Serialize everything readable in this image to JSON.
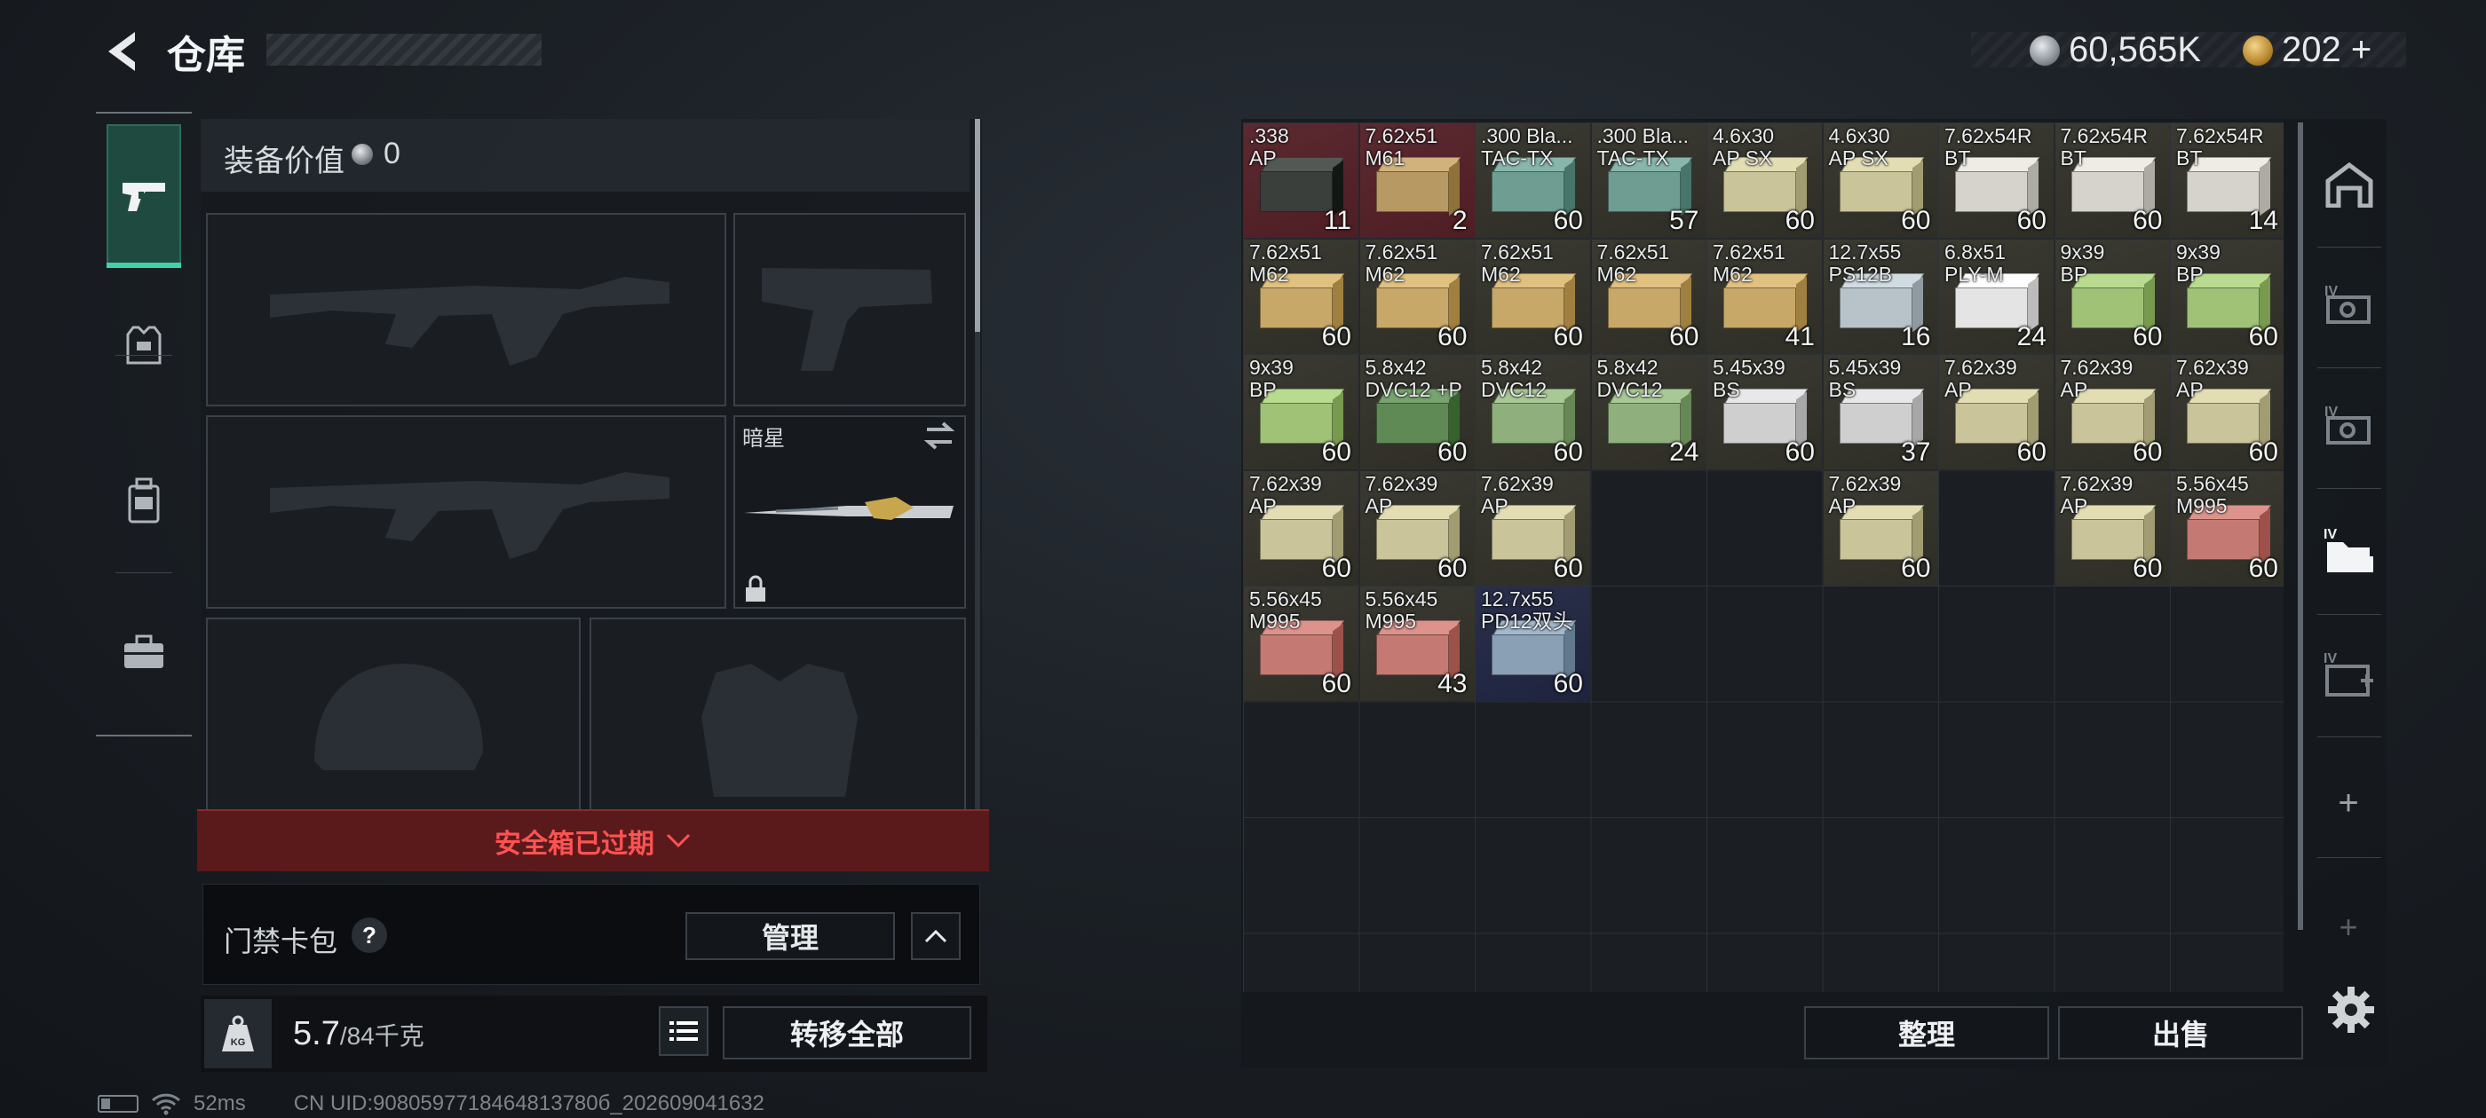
{
  "header": {
    "title": "仓库",
    "currency1": "60,565K",
    "currency2": "202",
    "currency2_add": "+"
  },
  "equipment": {
    "value_label": "装备价值",
    "value": "0",
    "melee_name": "暗星",
    "expired_text": "安全箱已过期",
    "card_pack_label": "门禁卡包",
    "help": "?",
    "manage_label": "管理",
    "weight_value": "5.7",
    "weight_max": "/84千克",
    "transfer_all_label": "转移全部",
    "kg_label": "KG"
  },
  "status": {
    "ping": "52ms",
    "uid": "CN UID:9080597718464813780б_202609041632"
  },
  "stash": {
    "sort_label": "整理",
    "sell_label": "出售",
    "items": [
      {
        "name": ".338\nAP",
        "count": "11",
        "color": "#3a3f3c",
        "bg": "#5a2a30"
      },
      {
        "name": "7.62x51\nM61",
        "count": "2",
        "color": "#b79a63",
        "bg": "#5a2a30"
      },
      {
        "name": ".300 Bla...\nTAC-TX",
        "count": "60",
        "color": "#6f9d92",
        "bg": "#3a3a32"
      },
      {
        "name": ".300 Bla...\nTAC-TX",
        "count": "57",
        "color": "#6f9d92",
        "bg": "#3a3a32"
      },
      {
        "name": "4.6x30\nAP SX",
        "count": "60",
        "color": "#c9c49a",
        "bg": "#3a3a32"
      },
      {
        "name": "4.6x30\nAP SX",
        "count": "60",
        "color": "#c9c49a",
        "bg": "#3a3a32"
      },
      {
        "name": "7.62x54R\nBT",
        "count": "60",
        "color": "#d6d3cc",
        "bg": "#3a3a32"
      },
      {
        "name": "7.62x54R\nBT",
        "count": "60",
        "color": "#d6d3cc",
        "bg": "#3a3a32"
      },
      {
        "name": "7.62x54R\nBT",
        "count": "14",
        "color": "#d6d3cc",
        "bg": "#3a3a32"
      },
      {
        "name": "7.62x51\nM62",
        "count": "60",
        "color": "#c8a868",
        "bg": "#3a3a32"
      },
      {
        "name": "7.62x51\nM62",
        "count": "60",
        "color": "#c8a868",
        "bg": "#3a3a32"
      },
      {
        "name": "7.62x51\nM62",
        "count": "60",
        "color": "#c8a868",
        "bg": "#3a3a32"
      },
      {
        "name": "7.62x51\nM62",
        "count": "60",
        "color": "#c8a868",
        "bg": "#3a3a32"
      },
      {
        "name": "7.62x51\nM62",
        "count": "41",
        "color": "#c8a868",
        "bg": "#3a3a32"
      },
      {
        "name": "12.7x55\nPS12B",
        "count": "16",
        "color": "#b7c3c8",
        "bg": "#3a3a32"
      },
      {
        "name": "6.8x51\nPLY-M",
        "count": "24",
        "color": "#e4e4e4",
        "bg": "#3a3a32"
      },
      {
        "name": "9x39\nBP",
        "count": "60",
        "color": "#9fc277",
        "bg": "#3a3a32"
      },
      {
        "name": "9x39\nBP",
        "count": "60",
        "color": "#9fc277",
        "bg": "#3a3a32"
      },
      {
        "name": "9x39\nBP",
        "count": "60",
        "color": "#9fc277",
        "bg": "#3a3a32"
      },
      {
        "name": "5.8x42\nDVC12 +P",
        "count": "60",
        "color": "#5f8a55",
        "bg": "#3a3a32"
      },
      {
        "name": "5.8x42\nDVC12",
        "count": "60",
        "color": "#8fb07c",
        "bg": "#3a3a32"
      },
      {
        "name": "5.8x42\nDVC12",
        "count": "24",
        "color": "#8fb07c",
        "bg": "#3a3a32"
      },
      {
        "name": "5.45x39\nBS",
        "count": "60",
        "color": "#cfcfcf",
        "bg": "#3a3a32"
      },
      {
        "name": "5.45x39\nBS",
        "count": "37",
        "color": "#cfcfcf",
        "bg": "#3a3a32"
      },
      {
        "name": "7.62x39\nAP",
        "count": "60",
        "color": "#c9c49a",
        "bg": "#3a3a32"
      },
      {
        "name": "7.62x39\nAP",
        "count": "60",
        "color": "#c9c49a",
        "bg": "#3a3a32"
      },
      {
        "name": "7.62x39\nAP",
        "count": "60",
        "color": "#c9c49a",
        "bg": "#3a3a32"
      },
      {
        "name": "7.62x39\nAP",
        "count": "60",
        "color": "#c9c49a",
        "bg": "#3a3a32"
      },
      {
        "name": "7.62x39\nAP",
        "count": "60",
        "color": "#c9c49a",
        "bg": "#3a3a32"
      },
      {
        "name": "7.62x39\nAP",
        "count": "60",
        "color": "#c9c49a",
        "bg": "#3a3a32"
      },
      {
        "name": "7.62x39\nAP",
        "count": "60",
        "color": "#c9c49a",
        "bg": "#3a3a32"
      },
      {
        "name": "7.62x39\nAP",
        "count": "60",
        "color": "#c9c49a",
        "bg": "#3a3a32"
      },
      {
        "name": "5.56x45\nM995",
        "count": "60",
        "color": "#c47a72",
        "bg": "#3a3a32"
      },
      {
        "name": "5.56x45\nM995",
        "count": "60",
        "color": "#c47a72",
        "bg": "#3a3a32"
      },
      {
        "name": "5.56x45\nM995",
        "count": "43",
        "color": "#c47a72",
        "bg": "#3a3a32"
      },
      {
        "name": "12.7x55\nPD12双头",
        "count": "60",
        "color": "#8aa0b4",
        "bg": "#2a2f4a"
      }
    ]
  }
}
